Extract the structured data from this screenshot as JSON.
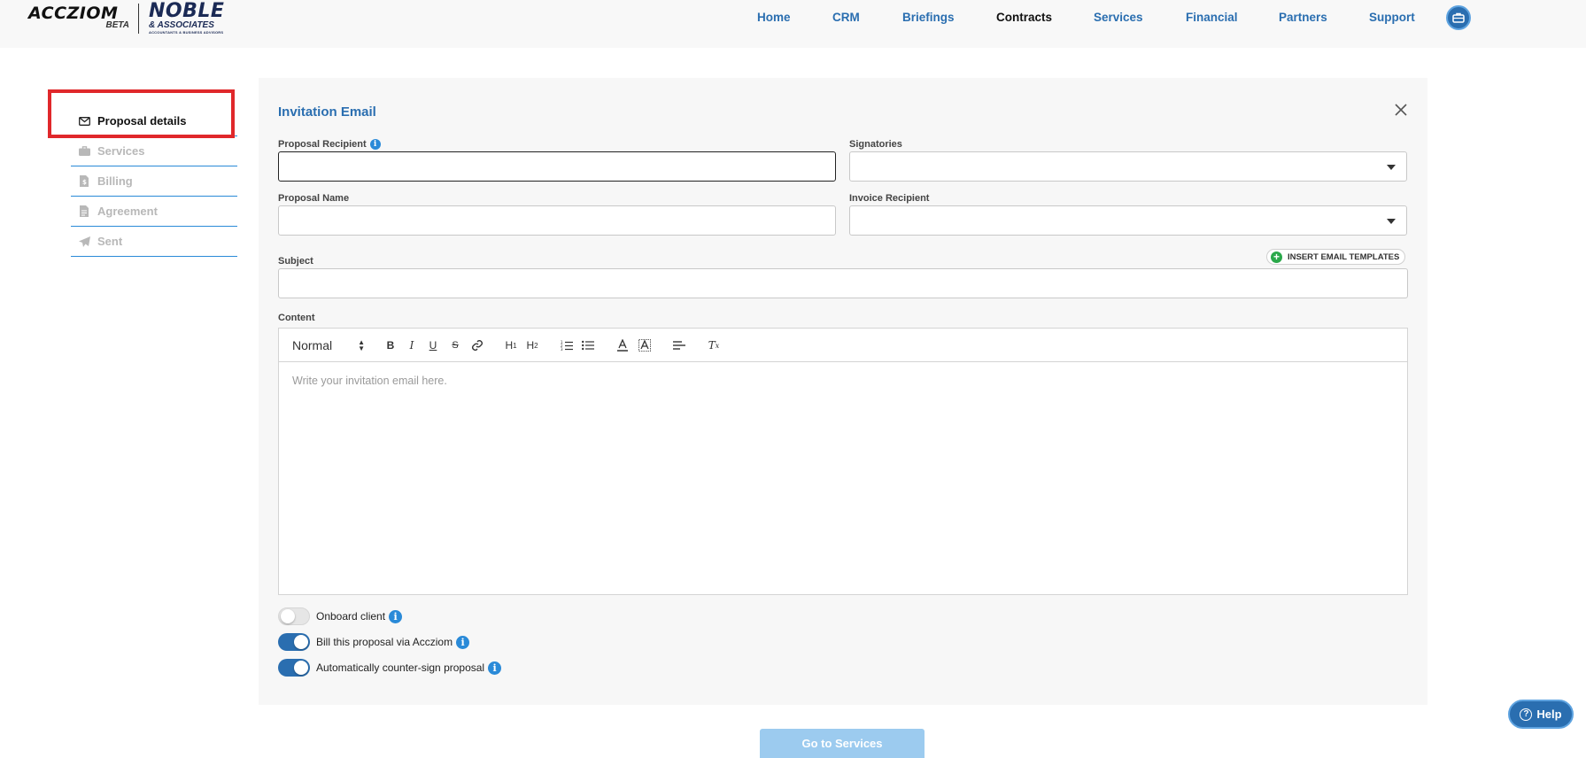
{
  "header": {
    "logo_primary": "ACCZIOM",
    "logo_beta": "BETA",
    "logo_secondary": "NOBLE",
    "logo_secondary_sub": "& ASSOCIATES",
    "logo_secondary_tag": "ACCOUNTANTS & BUSINESS ADVISORS",
    "nav": [
      {
        "label": "Home"
      },
      {
        "label": "CRM"
      },
      {
        "label": "Briefings"
      },
      {
        "label": "Contracts",
        "active": true
      },
      {
        "label": "Services"
      },
      {
        "label": "Financial"
      },
      {
        "label": "Partners"
      },
      {
        "label": "Support"
      }
    ],
    "profile_icon": "briefcase-icon"
  },
  "steps": [
    {
      "label": "Proposal details",
      "icon": "envelope-icon",
      "active": true
    },
    {
      "label": "Services",
      "icon": "briefcase-icon"
    },
    {
      "label": "Billing",
      "icon": "invoice-icon"
    },
    {
      "label": "Agreement",
      "icon": "document-icon"
    },
    {
      "label": "Sent",
      "icon": "paper-plane-icon"
    }
  ],
  "form": {
    "title": "Invitation Email",
    "proposal_recipient": {
      "label": "Proposal Recipient",
      "value": ""
    },
    "signatories": {
      "label": "Signatories",
      "value": ""
    },
    "proposal_name": {
      "label": "Proposal Name",
      "value": ""
    },
    "invoice_recipient": {
      "label": "Invoice Recipient",
      "value": ""
    },
    "subject": {
      "label": "Subject",
      "value": ""
    },
    "insert_templates_label": "INSERT EMAIL TEMPLATES",
    "content": {
      "label": "Content",
      "format_value": "Normal",
      "placeholder": "Write your invitation email here."
    },
    "toggles": [
      {
        "label": "Onboard client",
        "on": false
      },
      {
        "label": "Bill this proposal via Accziom",
        "on": true
      },
      {
        "label": "Automatically counter-sign proposal",
        "on": true
      }
    ]
  },
  "actions": {
    "next_label": "Go to Services",
    "help_label": "Help"
  },
  "colors": {
    "accent": "#2a6eb0",
    "accent_light": "#9ccbef",
    "highlight": "#e0282b",
    "template_plus": "#2aa84a"
  }
}
